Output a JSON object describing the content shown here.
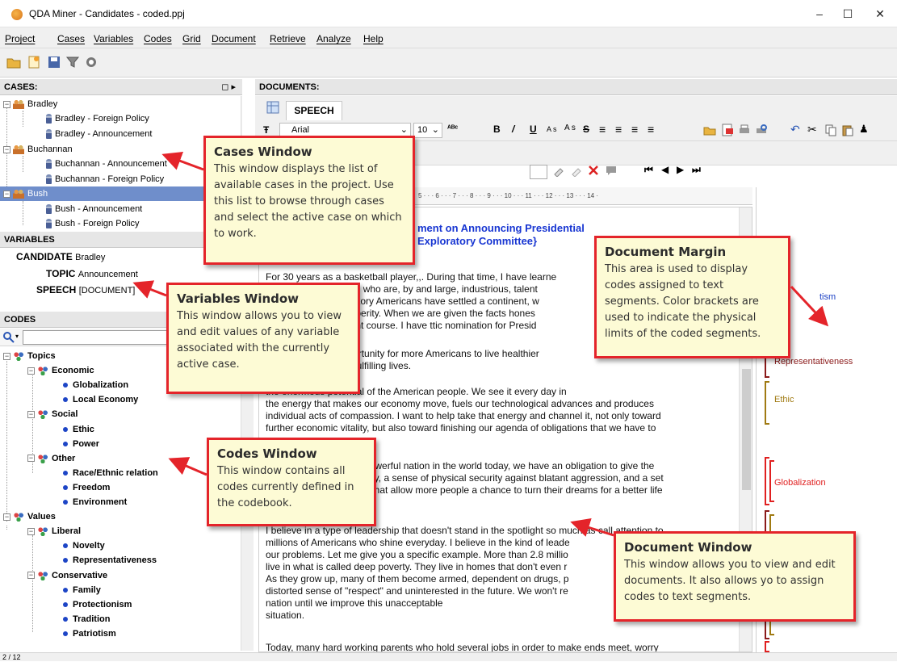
{
  "window": {
    "title": "QDA Miner - Candidates - coded.ppj",
    "controls": [
      "–",
      "☐",
      "✕"
    ]
  },
  "menu": [
    "Project",
    "Cases",
    "Variables",
    "Codes",
    "Grid",
    "Document",
    "Retrieve",
    "Analyze",
    "Help"
  ],
  "toolbar_icons": [
    "open-folder-icon",
    "new-project-icon",
    "save-icon",
    "filter-icon",
    "settings-gear-icon"
  ],
  "cases": {
    "header": "CASES:",
    "header_button": "◻ ▸",
    "items": [
      {
        "label": "Bradley",
        "level": 0
      },
      {
        "label": "Bradley - Foreign Policy",
        "level": 1
      },
      {
        "label": "Bradley - Announcement",
        "level": 1
      },
      {
        "label": "Buchannan",
        "level": 0
      },
      {
        "label": "Buchannan - Announcement",
        "level": 1
      },
      {
        "label": "Buchannan - Foreign Policy",
        "level": 1
      },
      {
        "label": "Bush",
        "level": 0,
        "selected": true
      },
      {
        "label": "Bush - Announcement",
        "level": 1
      },
      {
        "label": "Bush - Foreign Policy",
        "level": 1
      }
    ]
  },
  "variables": {
    "header": "VARIABLES",
    "rows": [
      {
        "name": "CANDIDATE",
        "value": "Bradley"
      },
      {
        "name": "TOPIC",
        "value": "Announcement"
      },
      {
        "name": "SPEECH",
        "value": "[DOCUMENT]"
      }
    ]
  },
  "codes": {
    "header": "CODES",
    "search_icon": "search-icon",
    "tree": [
      {
        "label": "Topics",
        "level": 0,
        "type": "folder"
      },
      {
        "label": "Economic",
        "level": 1,
        "type": "folder"
      },
      {
        "label": "Globalization",
        "level": 2,
        "type": "code"
      },
      {
        "label": "Local Economy",
        "level": 2,
        "type": "code"
      },
      {
        "label": "Social",
        "level": 1,
        "type": "folder"
      },
      {
        "label": "Ethic",
        "level": 2,
        "type": "code"
      },
      {
        "label": "Power",
        "level": 2,
        "type": "code"
      },
      {
        "label": "Other",
        "level": 1,
        "type": "folder"
      },
      {
        "label": "Race/Ethnic relation",
        "level": 2,
        "type": "code"
      },
      {
        "label": "Freedom",
        "level": 2,
        "type": "code"
      },
      {
        "label": "Environment",
        "level": 2,
        "type": "code"
      },
      {
        "label": "Values",
        "level": 0,
        "type": "folder"
      },
      {
        "label": "Liberal",
        "level": 1,
        "type": "folder"
      },
      {
        "label": "Novelty",
        "level": 2,
        "type": "code"
      },
      {
        "label": "Representativeness",
        "level": 2,
        "type": "code"
      },
      {
        "label": "Conservative",
        "level": 1,
        "type": "folder"
      },
      {
        "label": "Family",
        "level": 2,
        "type": "code"
      },
      {
        "label": "Protectionism",
        "level": 2,
        "type": "code"
      },
      {
        "label": "Tradition",
        "level": 2,
        "type": "code"
      },
      {
        "label": "Patriotism",
        "level": 2,
        "type": "code"
      }
    ]
  },
  "documents": {
    "header": "DOCUMENTS:",
    "tab": "SPEECH",
    "font_name": "Arial",
    "font_size": "10",
    "format_glyphs": [
      "B",
      "/",
      "U",
      "A s",
      "A s",
      "S",
      "≡",
      "≡",
      "≡",
      "≡"
    ],
    "nav_glyphs": [
      "⏮",
      "◀",
      "▶",
      "⏭"
    ],
    "ruler": "5 · · · 6 · · · 7 · · · 8 · · · 9 · · · 10 · · · 11 · · · 12 · · · 13 · · · 14 ·",
    "title_line1": "ment on Announcing Presidential",
    "title_line2": "Exploratory Committee}",
    "paragraphs": [
      "For 30 years as a basketball player,,. During that time, I have learne",
      "eople who are, by and large, industrious, talent",
      "rt history Americans have settled a continent, w",
      "prosperity. When we are given the facts hones",
      "e right course. I have ttic nomination for Presid",
      "opportunity for more Americans to live healthier",
      "ally fulfilling lives.",
      "the enormous potential of the American people. We see it every day in",
      "the energy that makes our economy move, fuels our technological advances and produces",
      "individual acts of compassion. I want to help take that energy and channel it, not only toward",
      "further economic vitality, but also toward finishing our agenda of obligations that we have to",
      "powerful nation in the world today, we have an obligation to give the",
      "acy, a sense of physical security against blatant aggression, and a set",
      "s that allow more people a chance to turn their dreams for a better life",
      "I believe in a type of leadership that doesn't stand in the spotlight so much as call attention to",
      "millions of Americans who shine everyday. I believe in the kind of leade",
      "our problems. Let me give you a specific example. More than 2.8 millio",
      "live in what is called deep poverty. They live in homes that don't even r",
      "As they grow up, many of them become armed, dependent on drugs, p",
      "distorted sense of \"respect\" and uninterested in the future. We won't re",
      "nation until we improve this unacceptable",
      "situation.",
      "Today, many hard working parents who hold several jobs in order to make ends meet, worry"
    ]
  },
  "margin_codes": [
    {
      "label": "tism",
      "color": "#1a3fc4"
    },
    {
      "label": "Representativeness",
      "color": "#8b1a1a"
    },
    {
      "label": "Ethic",
      "color": "#a07a12"
    },
    {
      "label": "Globalization",
      "color": "#e02020"
    }
  ],
  "callouts": [
    {
      "title": "Cases Window",
      "body": "This window displays the list of available cases in the project. Use this list to browse through cases and select the active case on which to work."
    },
    {
      "title": "Variables Window",
      "body": "This window allows you to view and edit values of any variable associated with the currently active case."
    },
    {
      "title": "Codes Window",
      "body": "This window contains all codes currently defined in the codebook."
    },
    {
      "title": "Document Margin",
      "body": "This area is used to display codes assigned to text segments. Color brackets are used to indicate the physical limits of the coded segments."
    },
    {
      "title": "Document Window",
      "body": "This window allows you to view and edit documents. It also allows yo to assign codes to text segments."
    }
  ],
  "status": "2 / 12"
}
